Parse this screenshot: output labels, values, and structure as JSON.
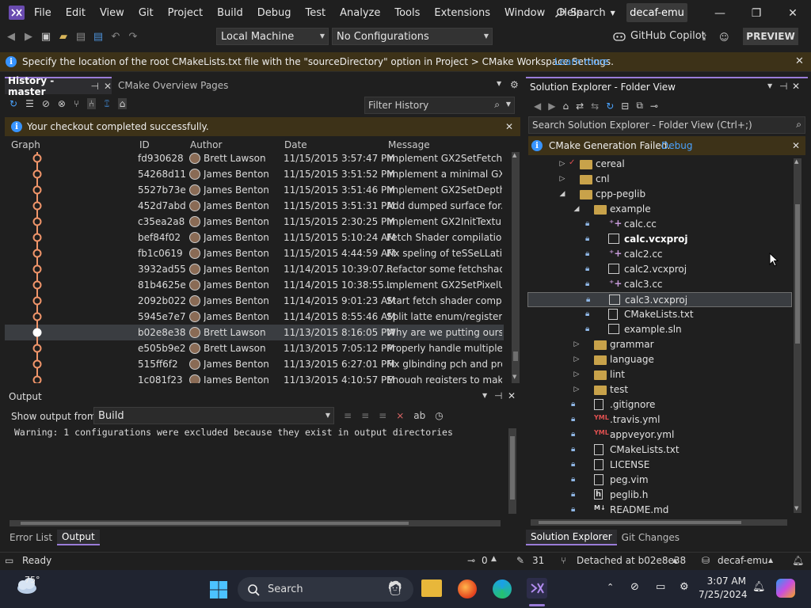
{
  "menu": {
    "items": [
      "File",
      "Edit",
      "View",
      "Git",
      "Project",
      "Build",
      "Debug",
      "Test",
      "Analyze",
      "Tools",
      "Extensions",
      "Window",
      "Help"
    ],
    "search_label": "Search",
    "solution_name": "decaf-emu"
  },
  "toolbar": {
    "target": "Local Machine",
    "config": "No Configurations",
    "copilot": "GitHub Copilot",
    "preview": "PREVIEW"
  },
  "infobar": {
    "message": "Specify the location of the root CMakeLists.txt file with the \"sourceDirectory\" option in Project > CMake Workspace Settings.",
    "link": "Learn more"
  },
  "history": {
    "tab_title": "History - master",
    "tab2": "CMake Overview Pages",
    "filter_placeholder": "Filter History",
    "notice": "Your checkout completed successfully.",
    "columns": [
      "Graph",
      "ID",
      "Author",
      "Date",
      "Message"
    ],
    "rows": [
      {
        "id": "fd930628",
        "author": "Brett Lawson",
        "date": "11/15/2015 3:57:47 PM",
        "msg": "Implement GX2SetFetchS..."
      },
      {
        "id": "54268d11",
        "author": "James Benton",
        "date": "11/15/2015 3:51:52 PM",
        "msg": "Implement a minimal GX..."
      },
      {
        "id": "5527b73e",
        "author": "James Benton",
        "date": "11/15/2015 3:51:46 PM",
        "msg": "Implement GX2SetDepth..."
      },
      {
        "id": "452d7abd",
        "author": "James Benton",
        "date": "11/15/2015 3:51:31 PM",
        "msg": "Add dumped surface for..."
      },
      {
        "id": "c35ea2a8",
        "author": "James Benton",
        "date": "11/15/2015 2:30:25 PM",
        "msg": "Implement GX2InitTextur..."
      },
      {
        "id": "bef84f02",
        "author": "James Benton",
        "date": "11/15/2015 5:10:24 AM",
        "msg": "Fetch Shader compilation..."
      },
      {
        "id": "fb1c0619",
        "author": "James Benton",
        "date": "11/15/2015 4:44:59 AM",
        "msg": "Fix speling of teSSeLLation."
      },
      {
        "id": "3932ad55",
        "author": "James Benton",
        "date": "11/14/2015 10:39:07...",
        "msg": "Refactor some fetchshad..."
      },
      {
        "id": "81b4625e",
        "author": "James Benton",
        "date": "11/14/2015 10:38:55...",
        "msg": "Implement GX2SetPixelU..."
      },
      {
        "id": "2092b022",
        "author": "James Benton",
        "date": "11/14/2015 9:01:23 AM",
        "msg": "Start fetch shader compiler."
      },
      {
        "id": "5945e7e7",
        "author": "James Benton",
        "date": "11/14/2015 8:55:46 AM",
        "msg": "Split latte enum/registers..."
      },
      {
        "id": "b02e8e38",
        "author": "Brett Lawson",
        "date": "11/13/2015 8:16:05 PM",
        "msg": "Why are we putting ourse..."
      },
      {
        "id": "e505b9e2",
        "author": "Brett Lawson",
        "date": "11/13/2015 7:05:12 PM",
        "msg": "Properly handle multiple..."
      },
      {
        "id": "515ff6f2",
        "author": "James Benton",
        "date": "11/13/2015 6:27:01 PM",
        "msg": "Fix glbinding pch and pro..."
      },
      {
        "id": "1c081f23",
        "author": "James Benton",
        "date": "11/13/2015 4:10:57 PM",
        "msg": "Enough registers to make..."
      }
    ]
  },
  "output": {
    "title": "Output",
    "show_from_label": "Show output from:",
    "source": "Build",
    "text": "Warning: 1 configurations were excluded because they exist in output directories",
    "tabs": [
      "Error List",
      "Output"
    ]
  },
  "solution": {
    "title": "Solution Explorer - Folder View",
    "search_placeholder": "Search Solution Explorer - Folder View (Ctrl+;)",
    "notice": "CMake Generation Failed.",
    "notice_link": "Debug",
    "tree": [
      {
        "label": "cereal",
        "type": "folder",
        "indent": 0,
        "chev": "right",
        "mark": "check"
      },
      {
        "label": "cnl",
        "type": "folder",
        "indent": 0,
        "chev": "right"
      },
      {
        "label": "cpp-peglib",
        "type": "folder",
        "indent": 0,
        "chev": "down"
      },
      {
        "label": "example",
        "type": "folder",
        "indent": 1,
        "chev": "down"
      },
      {
        "label": "calc.cc",
        "type": "cc",
        "indent": 2,
        "lock": true
      },
      {
        "label": "calc.vcxproj",
        "type": "proj",
        "indent": 2,
        "lock": true,
        "bold": true
      },
      {
        "label": "calc2.cc",
        "type": "cc",
        "indent": 2,
        "lock": true
      },
      {
        "label": "calc2.vcxproj",
        "type": "proj",
        "indent": 2,
        "lock": true
      },
      {
        "label": "calc3.cc",
        "type": "cc",
        "indent": 2,
        "lock": true
      },
      {
        "label": "calc3.vcxproj",
        "type": "proj",
        "indent": 2,
        "lock": true,
        "selected": true
      },
      {
        "label": "CMakeLists.txt",
        "type": "txt",
        "indent": 2,
        "lock": true
      },
      {
        "label": "example.sln",
        "type": "proj",
        "indent": 2,
        "lock": true
      },
      {
        "label": "grammar",
        "type": "folder",
        "indent": 1,
        "chev": "right"
      },
      {
        "label": "language",
        "type": "folder",
        "indent": 1,
        "chev": "right"
      },
      {
        "label": "lint",
        "type": "folder",
        "indent": 1,
        "chev": "right"
      },
      {
        "label": "test",
        "type": "folder",
        "indent": 1,
        "chev": "right"
      },
      {
        "label": ".gitignore",
        "type": "file",
        "indent": 1,
        "lock": true
      },
      {
        "label": ".travis.yml",
        "type": "yml",
        "indent": 1,
        "lock": true
      },
      {
        "label": "appveyor.yml",
        "type": "yml",
        "indent": 1,
        "lock": true
      },
      {
        "label": "CMakeLists.txt",
        "type": "txt",
        "indent": 1,
        "lock": true
      },
      {
        "label": "LICENSE",
        "type": "file",
        "indent": 1,
        "lock": true
      },
      {
        "label": "peg.vim",
        "type": "file",
        "indent": 1,
        "lock": true
      },
      {
        "label": "peglib.h",
        "type": "h",
        "indent": 1,
        "lock": true
      },
      {
        "label": "README.md",
        "type": "md",
        "indent": 1,
        "lock": true
      }
    ],
    "tabs": [
      "Solution Explorer",
      "Git Changes"
    ]
  },
  "statusbar": {
    "ready": "Ready",
    "up_count": "0",
    "edits": "31",
    "branch": "Detached at b02e8e38",
    "repo": "decaf-emu"
  },
  "taskbar": {
    "temp": "75°",
    "search": "Search",
    "time": "3:07 AM",
    "date": "7/25/2024"
  },
  "colors": {
    "accent": "#3794ff",
    "graph": "#f0956a",
    "vs_purple": "#8a5cd1",
    "selected": "#3a3d41"
  }
}
